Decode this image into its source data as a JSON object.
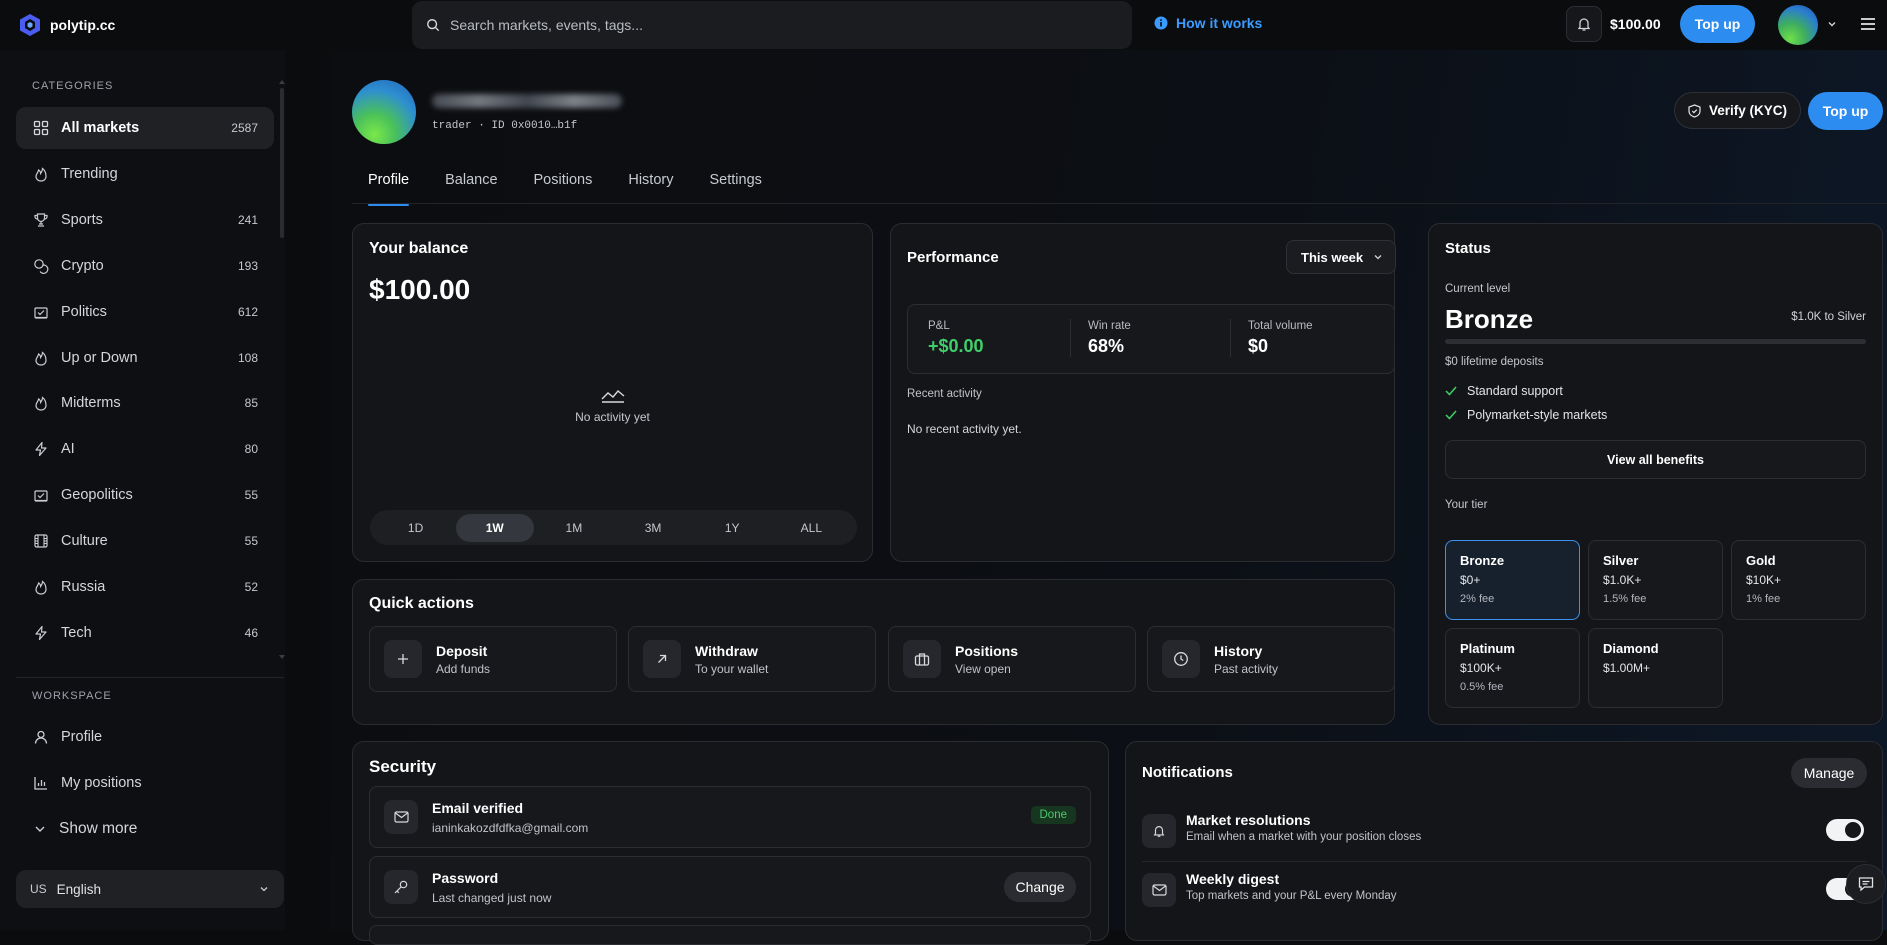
{
  "header": {
    "brand": "polytip.cc",
    "search_placeholder": "Search markets, events, tags...",
    "how_it_works": "How it works",
    "balance": "$100.00",
    "topup": "Top up"
  },
  "sidebar": {
    "categories_title": "CATEGORIES",
    "items": [
      {
        "label": "All markets",
        "count": "2587",
        "icon": "grid-icon"
      },
      {
        "label": "Trending",
        "count": "",
        "icon": "flame-icon"
      },
      {
        "label": "Sports",
        "count": "241",
        "icon": "trophy-icon"
      },
      {
        "label": "Crypto",
        "count": "193",
        "icon": "coins-icon"
      },
      {
        "label": "Politics",
        "count": "612",
        "icon": "ballot-icon"
      },
      {
        "label": "Up or Down",
        "count": "108",
        "icon": "flame-icon"
      },
      {
        "label": "Midterms",
        "count": "85",
        "icon": "flame-icon"
      },
      {
        "label": "AI",
        "count": "80",
        "icon": "bolt-icon"
      },
      {
        "label": "Geopolitics",
        "count": "55",
        "icon": "ballot-icon"
      },
      {
        "label": "Culture",
        "count": "55",
        "icon": "film-icon"
      },
      {
        "label": "Russia",
        "count": "52",
        "icon": "flame-icon"
      },
      {
        "label": "Tech",
        "count": "46",
        "icon": "bolt-icon"
      }
    ],
    "workspace_title": "WORKSPACE",
    "workspace": [
      {
        "label": "Profile",
        "icon": "user-icon"
      },
      {
        "label": "My positions",
        "icon": "bar-chart-icon"
      },
      {
        "label": "Show more",
        "icon": "chevron-down-icon"
      }
    ],
    "language": {
      "code": "US",
      "label": "English"
    }
  },
  "profile": {
    "meta": "trader · ID 0x0010…b1f",
    "verify": "Verify (KYC)",
    "topup": "Top up",
    "tabs": [
      "Profile",
      "Balance",
      "Positions",
      "History",
      "Settings"
    ]
  },
  "balance_card": {
    "title": "Your balance",
    "amount": "$100.00",
    "empty": "No activity yet",
    "ranges": [
      "1D",
      "1W",
      "1M",
      "3M",
      "1Y",
      "ALL"
    ],
    "selected_range": "1W"
  },
  "performance": {
    "title": "Performance",
    "period": "This week",
    "stats": [
      {
        "label": "P&L",
        "value": "+$0.00"
      },
      {
        "label": "Win rate",
        "value": "68%"
      },
      {
        "label": "Total volume",
        "value": "$0"
      }
    ],
    "recent_title": "Recent activity",
    "recent_empty": "No recent activity yet."
  },
  "status": {
    "title": "Status",
    "current_level_label": "Current level",
    "level": "Bronze",
    "to_next": "$1.0K to Silver",
    "progress": 0,
    "deposits": "$0 lifetime deposits",
    "benefits": [
      "Standard support",
      "Polymarket-style markets"
    ],
    "view_all": "View all benefits",
    "your_tier": "Your tier",
    "tiers": [
      {
        "name": "Bronze",
        "amount": "$0+",
        "fee": "2% fee"
      },
      {
        "name": "Silver",
        "amount": "$1.0K+",
        "fee": "1.5% fee"
      },
      {
        "name": "Gold",
        "amount": "$10K+",
        "fee": "1% fee"
      },
      {
        "name": "Platinum",
        "amount": "$100K+",
        "fee": "0.5% fee"
      },
      {
        "name": "Diamond",
        "amount": "$1.00M+",
        "fee": ""
      }
    ]
  },
  "quick_actions": {
    "title": "Quick actions",
    "items": [
      {
        "title": "Deposit",
        "sub": "Add funds",
        "icon": "plus-icon"
      },
      {
        "title": "Withdraw",
        "sub": "To your wallet",
        "icon": "arrow-up-right-icon"
      },
      {
        "title": "Positions",
        "sub": "View open",
        "icon": "briefcase-icon"
      },
      {
        "title": "History",
        "sub": "Past activity",
        "icon": "clock-icon"
      }
    ]
  },
  "security": {
    "title": "Security",
    "email": {
      "title": "Email verified",
      "sub": "ianinkakozdfdfka@gmail.com",
      "badge": "Done"
    },
    "password": {
      "title": "Password",
      "sub": "Last changed just now",
      "action": "Change"
    }
  },
  "notifications": {
    "title": "Notifications",
    "manage": "Manage",
    "items": [
      {
        "title": "Market resolutions",
        "sub": "Email when a market with your position closes",
        "on": true
      },
      {
        "title": "Weekly digest",
        "sub": "Top markets and your P&L every Monday",
        "on": true
      }
    ]
  },
  "colors": {
    "accent": "#2d8cf0",
    "positive": "#3fcf6a",
    "badge_done": "#4cc96e"
  }
}
